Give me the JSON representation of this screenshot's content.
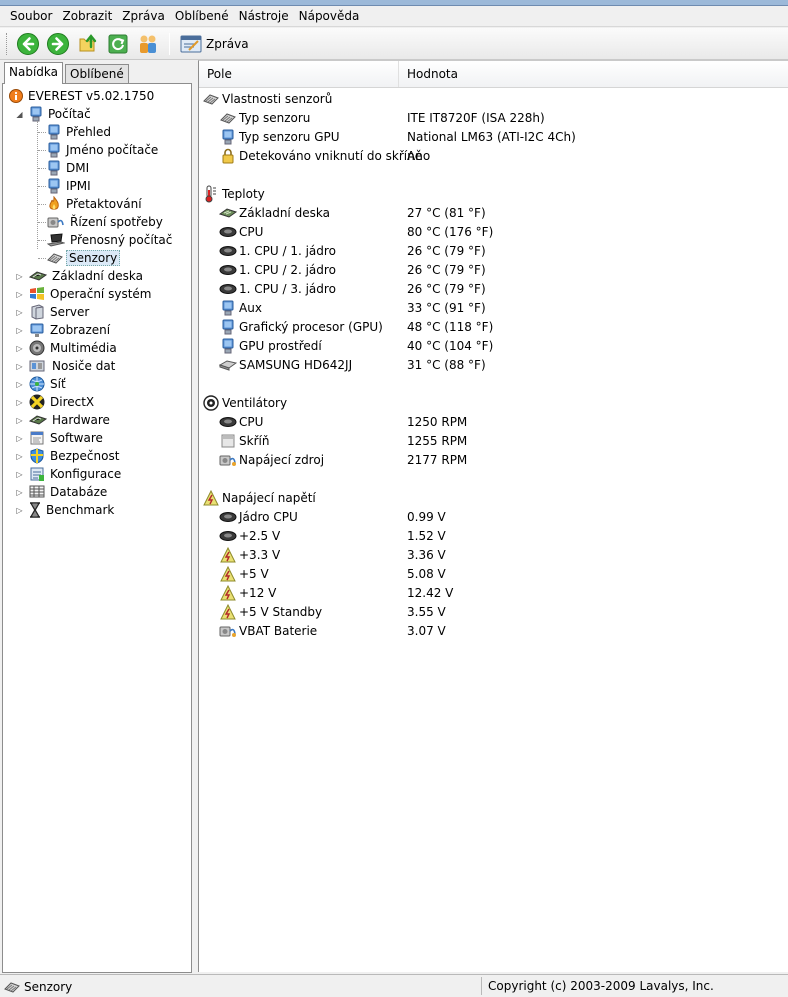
{
  "menu": [
    "Soubor",
    "Zobrazit",
    "Zpráva",
    "Oblíbené",
    "Nástroje",
    "Nápověda"
  ],
  "toolbar": {
    "buttons": [
      "back-icon",
      "forward-icon",
      "up-icon",
      "refresh-icon",
      "users-icon"
    ],
    "report_label": "Zpráva"
  },
  "tabs": {
    "menu": "Nabídka",
    "favorites": "Oblíbené"
  },
  "tree": {
    "root": "EVEREST v5.02.1750",
    "computer": "Počítač",
    "computer_children": [
      "Přehled",
      "Jméno počítače",
      "DMI",
      "IPMI",
      "Přetaktování",
      "Řízení spotřeby",
      "Přenosný počítač",
      "Senzory"
    ],
    "categories": [
      "Základní deska",
      "Operační systém",
      "Server",
      "Zobrazení",
      "Multimédia",
      "Nosiče dat",
      "Síť",
      "DirectX",
      "Hardware",
      "Software",
      "Bezpečnost",
      "Konfigurace",
      "Databáze",
      "Benchmark"
    ]
  },
  "columns": {
    "field": "Pole",
    "value": "Hodnota"
  },
  "sections": [
    {
      "title": "Vlastnosti senzorů",
      "icon": "sensor-icon",
      "rows": [
        {
          "field": "Typ senzoru",
          "value": "ITE IT8720F  (ISA 228h)",
          "icon": "sensor-icon"
        },
        {
          "field": "Typ senzoru GPU",
          "value": "National LM63  (ATI-I2C 4Ch)",
          "icon": "monitor-icon"
        },
        {
          "field": "Detekováno vniknutí do skříně",
          "value": "Ano",
          "icon": "lock-icon"
        }
      ]
    },
    {
      "title": "Teploty",
      "icon": "thermometer-icon",
      "rows": [
        {
          "field": "Základní deska",
          "value": "27 °C  (81 °F)",
          "icon": "board-icon"
        },
        {
          "field": "CPU",
          "value": "80 °C  (176 °F)",
          "icon": "chip-icon"
        },
        {
          "field": "1. CPU / 1. jádro",
          "value": "26 °C  (79 °F)",
          "icon": "chip-icon"
        },
        {
          "field": "1. CPU / 2. jádro",
          "value": "26 °C  (79 °F)",
          "icon": "chip-icon"
        },
        {
          "field": "1. CPU / 3. jádro",
          "value": "26 °C  (79 °F)",
          "icon": "chip-icon"
        },
        {
          "field": "Aux",
          "value": "33 °C  (91 °F)",
          "icon": "monitor-icon"
        },
        {
          "field": "Grafický procesor (GPU)",
          "value": "48 °C  (118 °F)",
          "icon": "monitor-icon"
        },
        {
          "field": "GPU prostředí",
          "value": "40 °C  (104 °F)",
          "icon": "monitor-icon"
        },
        {
          "field": "SAMSUNG HD642JJ",
          "value": "31 °C  (88 °F)",
          "icon": "disk-icon"
        }
      ]
    },
    {
      "title": "Ventilátory",
      "icon": "fan-icon",
      "rows": [
        {
          "field": "CPU",
          "value": "1250 RPM",
          "icon": "chip-icon"
        },
        {
          "field": "Skříň",
          "value": "1255 RPM",
          "icon": "case-icon"
        },
        {
          "field": "Napájecí zdroj",
          "value": "2177 RPM",
          "icon": "power-icon"
        }
      ]
    },
    {
      "title": "Napájecí napětí",
      "icon": "voltage-icon",
      "rows": [
        {
          "field": "Jádro CPU",
          "value": "0.99 V",
          "icon": "chip-icon"
        },
        {
          "field": "+2.5 V",
          "value": "1.52 V",
          "icon": "chip-icon"
        },
        {
          "field": "+3.3 V",
          "value": "3.36 V",
          "icon": "voltage-icon"
        },
        {
          "field": "+5 V",
          "value": "5.08 V",
          "icon": "voltage-icon"
        },
        {
          "field": "+12 V",
          "value": "12.42 V",
          "icon": "voltage-icon"
        },
        {
          "field": "+5 V Standby",
          "value": "3.55 V",
          "icon": "voltage-icon"
        },
        {
          "field": "VBAT Baterie",
          "value": "3.07 V",
          "icon": "power-icon"
        }
      ]
    }
  ],
  "status": {
    "left": "Senzory",
    "right": "Copyright (c) 2003-2009 Lavalys, Inc."
  }
}
